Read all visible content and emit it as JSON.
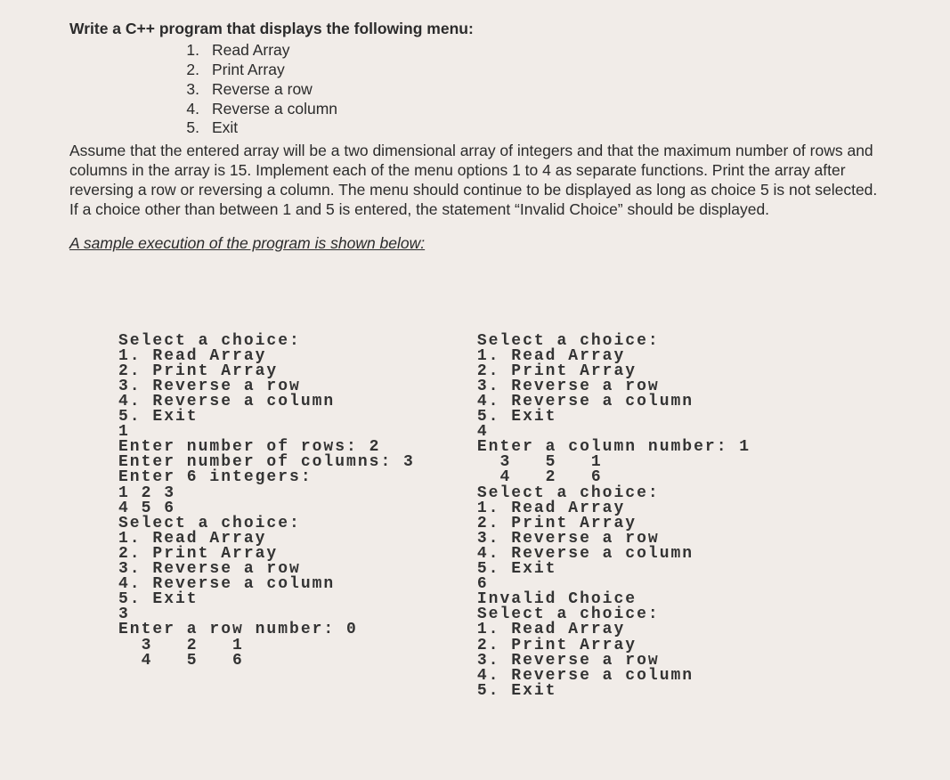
{
  "question": {
    "title": "Write a C++ program that displays the following menu:",
    "menu": [
      {
        "n": "1.",
        "t": "Read Array"
      },
      {
        "n": "2.",
        "t": "Print Array"
      },
      {
        "n": "3.",
        "t": "Reverse a row"
      },
      {
        "n": "4.",
        "t": "Reverse a column"
      },
      {
        "n": "5.",
        "t": "Exit"
      }
    ],
    "paragraph": "Assume that the entered array will be a two dimensional array of integers and that the maximum number of rows and columns in the array is 15. Implement each of the menu options 1 to 4 as separate functions. Print the array after reversing a row or reversing a column.  The menu should continue to be displayed as long as choice 5 is not selected. If a choice other than between 1 and 5 is entered, the statement “Invalid Choice” should be displayed.",
    "sample_label": "A sample execution of the program is shown below:"
  },
  "console_left": "Select a choice:\n1. Read Array\n2. Print Array\n3. Reverse a row\n4. Reverse a column\n5. Exit\n1\nEnter number of rows: 2\nEnter number of columns: 3\nEnter 6 integers:\n1 2 3\n4 5 6\nSelect a choice:\n1. Read Array\n2. Print Array\n3. Reverse a row\n4. Reverse a column\n5. Exit\n3\nEnter a row number: 0\n  3   2   1\n  4   5   6",
  "console_right": "Select a choice:\n1. Read Array\n2. Print Array\n3. Reverse a row\n4. Reverse a column\n5. Exit\n4\nEnter a column number: 1\n  3   5   1\n  4   2   6\nSelect a choice:\n1. Read Array\n2. Print Array\n3. Reverse a row\n4. Reverse a column\n5. Exit\n6\nInvalid Choice\nSelect a choice:\n1. Read Array\n2. Print Array\n3. Reverse a row\n4. Reverse a column\n5. Exit"
}
